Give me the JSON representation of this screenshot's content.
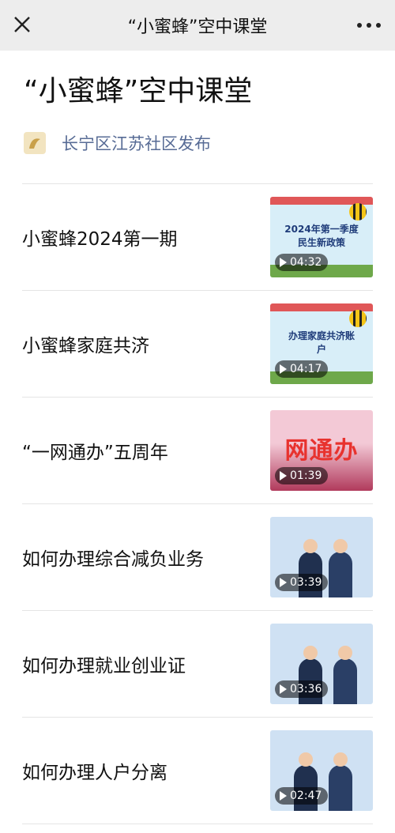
{
  "topbar": {
    "title": "“小蜜蜂”空中课堂"
  },
  "header": {
    "title": "“小蜜蜂”空中课堂",
    "account": "长宁区江苏社区发布"
  },
  "items": [
    {
      "label": "小蜜蜂2024第一期",
      "duration": "04:32",
      "thumb_text": "2024年第一季度 民生新政策",
      "thumb_bg": "#d8eef8"
    },
    {
      "label": "小蜜蜂家庭共济",
      "duration": "04:17",
      "thumb_text": "办理家庭共济账户",
      "thumb_bg": "#d8eef8"
    },
    {
      "label": "“一网通办”五周年",
      "duration": "01:39",
      "thumb_text": "网通办",
      "thumb_bg": "#f3c9d6"
    },
    {
      "label": "如何办理综合减负业务",
      "duration": "03:39",
      "thumb_text": "",
      "thumb_bg": "#cfe1f3"
    },
    {
      "label": "如何办理就业创业证",
      "duration": "03:36",
      "thumb_text": "",
      "thumb_bg": "#cfe1f3"
    },
    {
      "label": "如何办理人户分离",
      "duration": "02:47",
      "thumb_text": "",
      "thumb_bg": "#cfe1f3"
    }
  ]
}
